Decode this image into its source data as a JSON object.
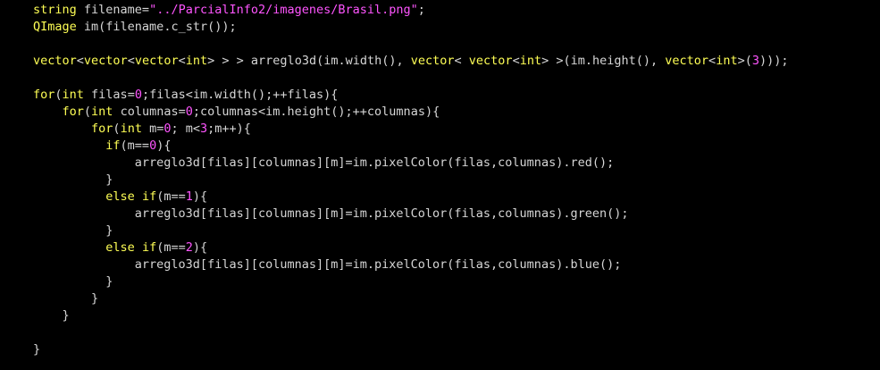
{
  "colors": {
    "background": "#000000",
    "plain": "#d6d6d6",
    "keyword": "#ffff55",
    "literal": "#ff55ff"
  },
  "code": {
    "lines": [
      [
        {
          "t": "k",
          "v": "string"
        },
        {
          "t": "p",
          "v": " filename="
        },
        {
          "t": "s",
          "v": "\"../ParcialInfo2/imagenes/Brasil.png\""
        },
        {
          "t": "p",
          "v": ";"
        }
      ],
      [
        {
          "t": "k",
          "v": "QImage"
        },
        {
          "t": "p",
          "v": " im(filename.c_str());"
        }
      ],
      [],
      [
        {
          "t": "k",
          "v": "vector"
        },
        {
          "t": "p",
          "v": "<"
        },
        {
          "t": "k",
          "v": "vector"
        },
        {
          "t": "p",
          "v": "<"
        },
        {
          "t": "k",
          "v": "vector"
        },
        {
          "t": "p",
          "v": "<"
        },
        {
          "t": "k",
          "v": "int"
        },
        {
          "t": "p",
          "v": "> > > arreglo3d(im.width(), "
        },
        {
          "t": "k",
          "v": "vector"
        },
        {
          "t": "p",
          "v": "< "
        },
        {
          "t": "k",
          "v": "vector"
        },
        {
          "t": "p",
          "v": "<"
        },
        {
          "t": "k",
          "v": "int"
        },
        {
          "t": "p",
          "v": "> >(im.height(), "
        },
        {
          "t": "k",
          "v": "vector"
        },
        {
          "t": "p",
          "v": "<"
        },
        {
          "t": "k",
          "v": "int"
        },
        {
          "t": "p",
          "v": ">("
        },
        {
          "t": "n",
          "v": "3"
        },
        {
          "t": "p",
          "v": ")));"
        }
      ],
      [],
      [
        {
          "t": "k",
          "v": "for"
        },
        {
          "t": "p",
          "v": "("
        },
        {
          "t": "k",
          "v": "int"
        },
        {
          "t": "p",
          "v": " filas="
        },
        {
          "t": "n",
          "v": "0"
        },
        {
          "t": "p",
          "v": ";filas<im.width();++filas){"
        }
      ],
      [
        {
          "t": "p",
          "v": "    "
        },
        {
          "t": "k",
          "v": "for"
        },
        {
          "t": "p",
          "v": "("
        },
        {
          "t": "k",
          "v": "int"
        },
        {
          "t": "p",
          "v": " columnas="
        },
        {
          "t": "n",
          "v": "0"
        },
        {
          "t": "p",
          "v": ";columnas<im.height();++columnas){"
        }
      ],
      [
        {
          "t": "p",
          "v": "        "
        },
        {
          "t": "k",
          "v": "for"
        },
        {
          "t": "p",
          "v": "("
        },
        {
          "t": "k",
          "v": "int"
        },
        {
          "t": "p",
          "v": " m="
        },
        {
          "t": "n",
          "v": "0"
        },
        {
          "t": "p",
          "v": "; m<"
        },
        {
          "t": "n",
          "v": "3"
        },
        {
          "t": "p",
          "v": ";m++){"
        }
      ],
      [
        {
          "t": "p",
          "v": "          "
        },
        {
          "t": "k",
          "v": "if"
        },
        {
          "t": "p",
          "v": "(m=="
        },
        {
          "t": "n",
          "v": "0"
        },
        {
          "t": "p",
          "v": "){"
        }
      ],
      [
        {
          "t": "p",
          "v": "              arreglo3d[filas][columnas][m]=im.pixelColor(filas,columnas).red();"
        }
      ],
      [
        {
          "t": "p",
          "v": "          }"
        }
      ],
      [
        {
          "t": "p",
          "v": "          "
        },
        {
          "t": "k",
          "v": "else"
        },
        {
          "t": "p",
          "v": " "
        },
        {
          "t": "k",
          "v": "if"
        },
        {
          "t": "p",
          "v": "(m=="
        },
        {
          "t": "n",
          "v": "1"
        },
        {
          "t": "p",
          "v": "){"
        }
      ],
      [
        {
          "t": "p",
          "v": "              arreglo3d[filas][columnas][m]=im.pixelColor(filas,columnas).green();"
        }
      ],
      [
        {
          "t": "p",
          "v": "          }"
        }
      ],
      [
        {
          "t": "p",
          "v": "          "
        },
        {
          "t": "k",
          "v": "else"
        },
        {
          "t": "p",
          "v": " "
        },
        {
          "t": "k",
          "v": "if"
        },
        {
          "t": "p",
          "v": "(m=="
        },
        {
          "t": "n",
          "v": "2"
        },
        {
          "t": "p",
          "v": "){"
        }
      ],
      [
        {
          "t": "p",
          "v": "              arreglo3d[filas][columnas][m]=im.pixelColor(filas,columnas).blue();"
        }
      ],
      [
        {
          "t": "p",
          "v": "          }"
        }
      ],
      [
        {
          "t": "p",
          "v": "        }"
        }
      ],
      [
        {
          "t": "p",
          "v": "    }"
        }
      ],
      [],
      [
        {
          "t": "p",
          "v": "}"
        }
      ]
    ]
  }
}
